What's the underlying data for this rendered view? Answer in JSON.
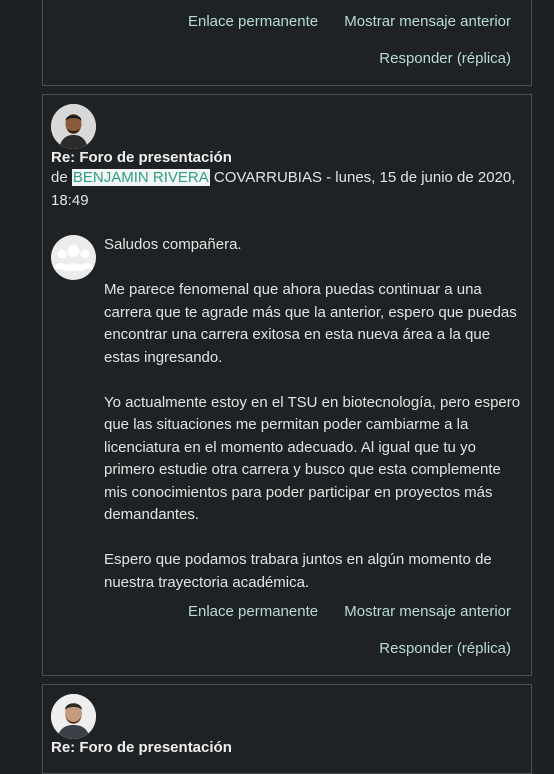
{
  "prev_post": {
    "permalink": "Enlace permanente",
    "show_parent": "Mostrar mensaje anterior",
    "reply": "Responder (réplica)"
  },
  "main_post": {
    "subject": "Re: Foro de presentación",
    "by_prefix": "de",
    "author_link": "BENJAMIN RIVERA",
    "author_rest": "COVARRUBIAS",
    "date": " - lunes, 15 de junio de 2020, 18:49",
    "paragraphs": [
      "Saludos compañera.",
      "Me parece fenomenal que ahora puedas continuar a una carrera que te agrade más que la anterior, espero que puedas encontrar una carrera exitosa en esta nueva área a la que estas ingresando.",
      "Yo actualmente estoy en el TSU en biotecnología, pero espero que las situaciones me permitan poder cambiarme a la licenciatura en el momento adecuado. Al igual que tu yo primero estudie otra carrera y busco que esta complemente mis conocimientos para poder participar en proyectos más demandantes.",
      "Espero que podamos trabara juntos en algún momento de nuestra trayectoria académica."
    ],
    "permalink": "Enlace permanente",
    "show_parent": "Mostrar mensaje anterior",
    "reply": "Responder (réplica)"
  },
  "next_post": {
    "subject": "Re: Foro de presentación"
  }
}
